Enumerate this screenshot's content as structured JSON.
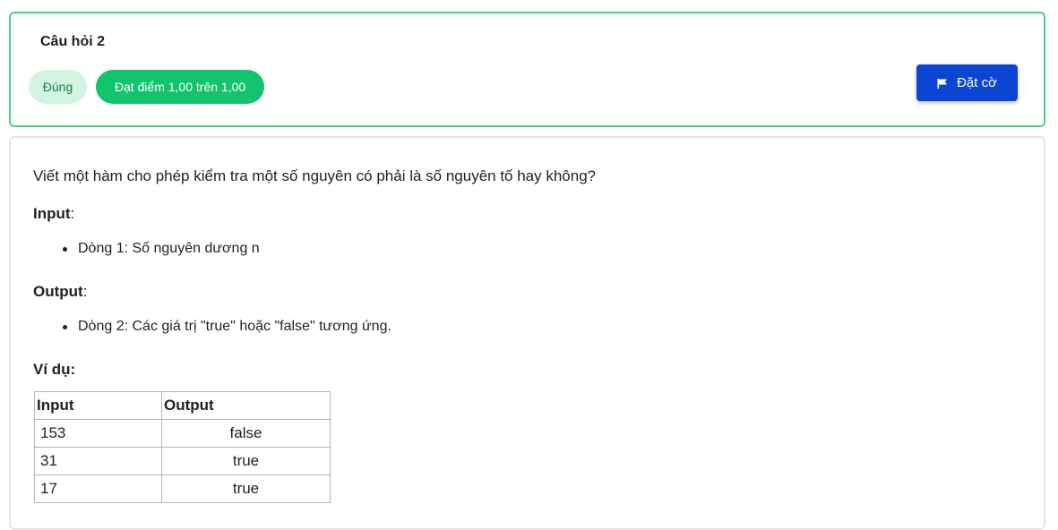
{
  "question": {
    "title": "Câu hỏi 2",
    "status_badge": "Đúng",
    "grade_badge": "Đạt điểm 1,00 trên 1,00",
    "flag_button": "Đặt cờ",
    "colors": {
      "correct_border": "#4bd08b",
      "grade_badge_bg": "#13c46d",
      "status_badge_bg": "#d1f5e2",
      "flag_button_bg": "#0b45d4"
    },
    "icons": {
      "flag": "flag-icon"
    }
  },
  "content": {
    "prompt": "Viết một hàm cho phép kiểm tra một số nguyên có phải là số nguyên tố hay không?",
    "input_label": "Input",
    "input_colon": ":",
    "input_items": [
      "Dòng 1:  Số nguyên dương n"
    ],
    "output_label": "Output",
    "output_colon": ":",
    "output_items": [
      "Dòng 2: Các giá trị \"true\" hoặc \"false\" tương ứng."
    ],
    "example_label": "Ví dụ:",
    "table": {
      "headers": [
        "Input",
        "Output"
      ],
      "rows": [
        [
          "153",
          "false"
        ],
        [
          "31",
          "true"
        ],
        [
          "17",
          "true"
        ]
      ]
    }
  }
}
